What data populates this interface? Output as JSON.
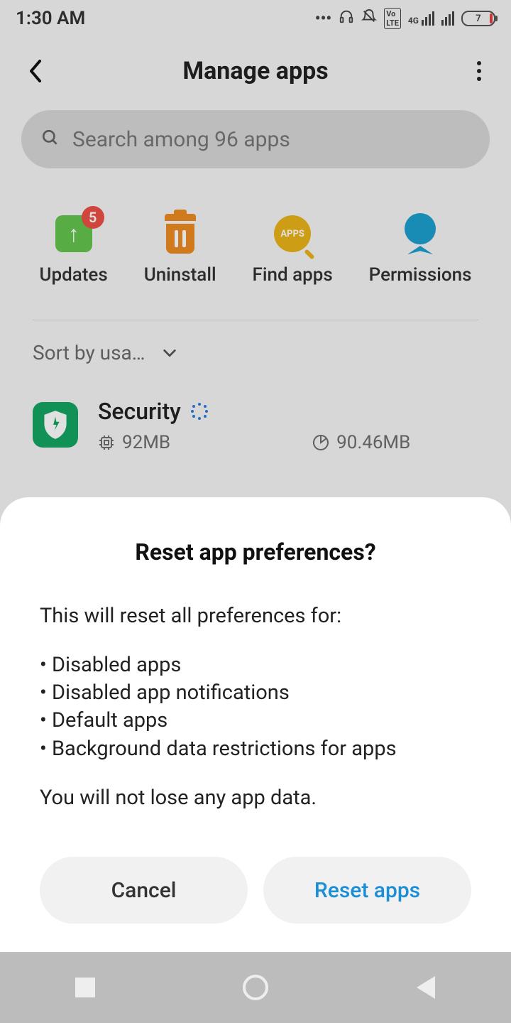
{
  "status": {
    "time": "1:30 AM",
    "battery_percent": 7,
    "network_indicator": "4G",
    "volte": "VoLTE"
  },
  "header": {
    "title": "Manage apps"
  },
  "search": {
    "placeholder": "Search among 96 apps"
  },
  "actions": {
    "updates": {
      "label": "Updates",
      "badge": "5"
    },
    "uninstall": {
      "label": "Uninstall"
    },
    "find": {
      "label": "Find apps",
      "icon_text": "APPS"
    },
    "permissions": {
      "label": "Permissions"
    }
  },
  "sort": {
    "label": "Sort by usa…"
  },
  "apps": [
    {
      "name": "Security",
      "ram": "92MB",
      "storage": "90.46MB"
    }
  ],
  "dialog": {
    "title": "Reset app preferences?",
    "intro": "This will reset all preferences for:",
    "items": [
      "Disabled apps",
      "Disabled app notifications",
      "Default apps",
      "Background data restrictions for apps"
    ],
    "footer": "You will not lose any app data.",
    "cancel": "Cancel",
    "confirm": "Reset apps"
  }
}
